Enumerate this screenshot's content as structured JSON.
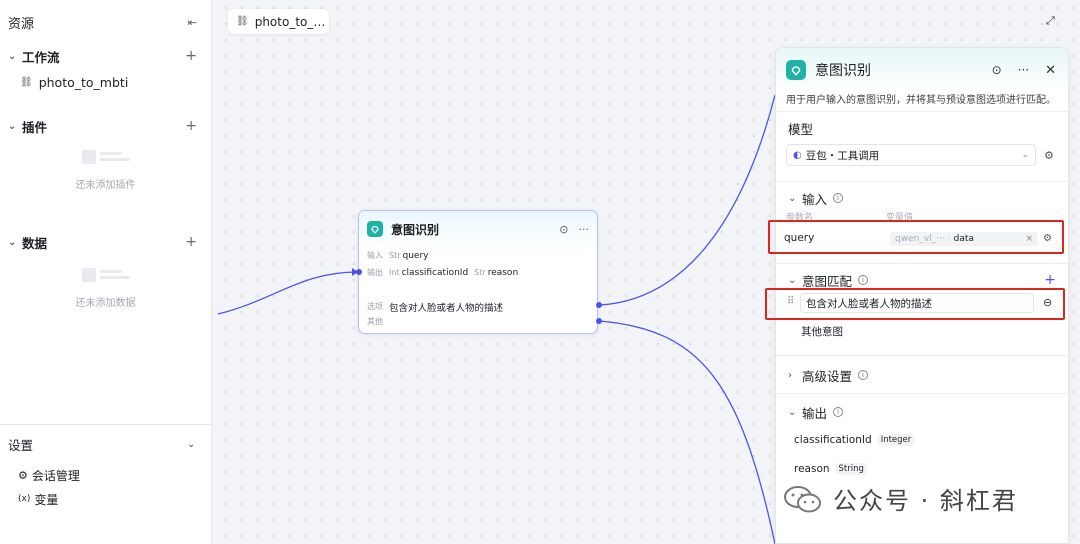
{
  "sidebar": {
    "title": "资源",
    "sections": {
      "workflow": {
        "label": "工作流",
        "items": [
          "photo_to_mbti"
        ]
      },
      "plugin": {
        "label": "插件",
        "empty_text": "还未添加插件"
      },
      "data": {
        "label": "数据",
        "empty_text": "还未添加数据"
      }
    },
    "settings": {
      "label": "设置",
      "items": [
        {
          "icon": "session-icon",
          "label": "会话管理"
        },
        {
          "icon": "variable-icon",
          "label": "变量",
          "glyph": "(x)"
        }
      ]
    }
  },
  "tab": {
    "label": "photo_to_…"
  },
  "node": {
    "title": "意图识别",
    "input_label": "输入",
    "output_label": "输出",
    "input_param": {
      "type": "Str",
      "name": "query"
    },
    "outputs": [
      {
        "type": "Int",
        "name": "classificationId"
      },
      {
        "type": "Str",
        "name": "reason"
      }
    ],
    "option_label": "选项",
    "option_value": "包含对人脸或者人物的描述",
    "other_label": "其他"
  },
  "panel": {
    "title": "意图识别",
    "description": "用于用户输入的意图识别，并将其与预设意图选项进行匹配。",
    "model": {
      "label": "模型",
      "value": "豆包・工具调用"
    },
    "input": {
      "label": "输入",
      "col_name": "参数名",
      "col_value": "变量值",
      "param": "query",
      "ref_source": "qwen_vl_···",
      "ref_field": "data"
    },
    "intent": {
      "label": "意图匹配",
      "option": "包含对人脸或者人物的描述",
      "other": "其他意图"
    },
    "advanced": {
      "label": "高级设置"
    },
    "output": {
      "label": "输出",
      "items": [
        {
          "name": "classificationId",
          "type": "Integer"
        },
        {
          "name": "reason",
          "type": "String"
        }
      ]
    }
  },
  "watermark": {
    "text": "公众号 · 斜杠君"
  },
  "colors": {
    "accent": "#4d53e8",
    "teal": "#1fb3a6",
    "highlight": "#e0251e"
  }
}
